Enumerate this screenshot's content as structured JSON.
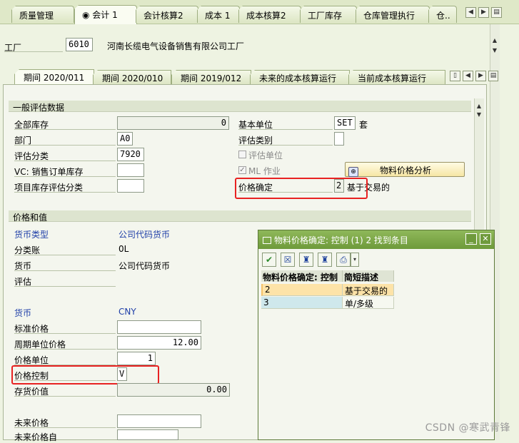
{
  "top_tabs": [
    {
      "label": "质量管理",
      "active": false
    },
    {
      "label": "会计 1",
      "active": true
    },
    {
      "label": "会计核算2",
      "active": false
    },
    {
      "label": "成本 1",
      "active": false
    },
    {
      "label": "成本核算2",
      "active": false
    },
    {
      "label": "工厂库存",
      "active": false
    },
    {
      "label": "仓库管理执行",
      "active": false
    },
    {
      "label": "仓..",
      "active": false
    }
  ],
  "header": {
    "plant_label": "工厂",
    "plant_value": "6010",
    "plant_name": "河南长缆电气设备销售有限公司工厂"
  },
  "inner_tabs": [
    {
      "label": "期间 2020/011",
      "active": true
    },
    {
      "label": "期间 2020/010",
      "active": false
    },
    {
      "label": "期间 2019/012",
      "active": false
    },
    {
      "label": "未来的成本核算运行",
      "active": false
    },
    {
      "label": "当前成本核算运行",
      "active": false
    }
  ],
  "general": {
    "title": "一般评估数据",
    "total_stock_label": "全部库存",
    "total_stock_value": "0",
    "department_label": "部门",
    "department_value": "A0",
    "valuation_class_label": "评估分类",
    "valuation_class_value": "7920",
    "vc_label": "VC: 销售订单库存",
    "vc_value": "",
    "project_stock_label": "项目库存评估分类",
    "project_stock_value": "",
    "base_unit_label": "基本单位",
    "base_unit_value": "SET",
    "base_unit_text": "套",
    "valuation_category_label": "评估类别",
    "valuation_unit_label": "评估单位",
    "ml_label": "ML 作业",
    "analysis_button": "物料价格分析",
    "price_det_label": "价格确定",
    "price_det_value": "2",
    "price_det_text": "基于交易的"
  },
  "prices": {
    "title": "价格和值",
    "currency_type_label": "货币类型",
    "currency_type_value": "公司代码货币",
    "ledger_label": "分类账",
    "ledger_value": "0L",
    "currency_label": "货币",
    "currency_value": "公司代码货币",
    "valuation_label": "评估",
    "currency2_label": "货币",
    "currency2_value": "CNY",
    "std_price_label": "标准价格",
    "std_price_value": "",
    "periodic_price_label": "周期单位价格",
    "periodic_price_value": "12.00",
    "price_unit_label": "价格单位",
    "price_unit_value": "1",
    "price_control_label": "价格控制",
    "price_control_value": "V",
    "inventory_value_label": "存货价值",
    "inventory_value_value": "0.00",
    "future_price_label": "未来价格",
    "future_price_from_label": "未来价格自"
  },
  "popup": {
    "title": "物料价格确定: 控制 (1)   2 找到条目",
    "col1": "物料价格确定: 控制",
    "col2": "简短描述",
    "rows": [
      {
        "code": "2",
        "desc": "基于交易的"
      },
      {
        "code": "3",
        "desc": "单/多级"
      }
    ]
  },
  "watermark": "CSDN @寒武青锋",
  "colors": {
    "accent": "#6e9a3a",
    "highlight": "#fde3a8",
    "blue_label": "#1f3fa8",
    "red_box": "#e82222"
  }
}
